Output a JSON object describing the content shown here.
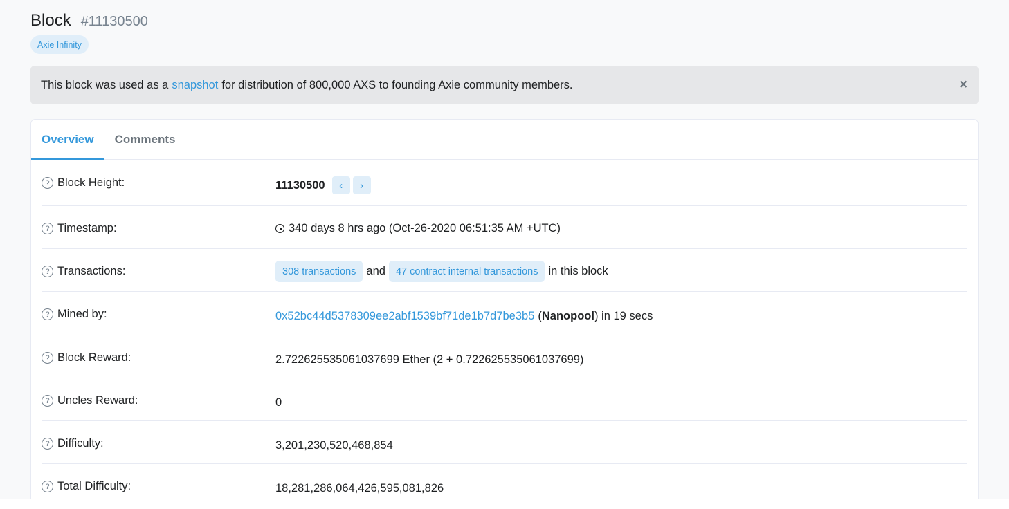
{
  "header": {
    "title": "Block",
    "block_hash_label": "#11130500",
    "tag": "Axie Infinity"
  },
  "alert": {
    "text_before": "This block was used as a",
    "link_text": "snapshot",
    "text_after": "for distribution of 800,000 AXS to founding Axie community members.",
    "close_symbol": "×"
  },
  "tabs": [
    {
      "label": "Overview",
      "active": true
    },
    {
      "label": "Comments",
      "active": false
    }
  ],
  "rows": {
    "block_height": {
      "label": "Block Height:",
      "value": "11130500",
      "prev_icon": "chevron-left-icon",
      "next_icon": "chevron-right-icon"
    },
    "timestamp": {
      "label": "Timestamp:",
      "value": "340 days 8 hrs ago (Oct-26-2020 06:51:35 AM +UTC)"
    },
    "transactions": {
      "label": "Transactions:",
      "tx_pill": "308 transactions",
      "and_text": "and",
      "internal_pill": "47 contract internal transactions",
      "suffix": "in this block"
    },
    "mined_by": {
      "label": "Mined by:",
      "address": "0x52bc44d5378309ee2abf1539bf71de1b7d7be3b5",
      "open_paren": "(",
      "pool": "Nanopool",
      "suffix": ") in 19 secs"
    },
    "block_reward": {
      "label": "Block Reward:",
      "value": "2.722625535061037699 Ether (2 + 0.722625535061037699)"
    },
    "uncles_reward": {
      "label": "Uncles Reward:",
      "value": "0"
    },
    "difficulty": {
      "label": "Difficulty:",
      "value": "3,201,230,520,468,854"
    },
    "total_difficulty": {
      "label": "Total Difficulty:",
      "value": "18,281,286,064,426,595,081,826"
    }
  },
  "colors": {
    "accent": "#3498db",
    "pill_bg": "#e0eef9",
    "alert_bg": "#e6e7e9",
    "text": "#1e2022",
    "muted": "#77838f"
  }
}
